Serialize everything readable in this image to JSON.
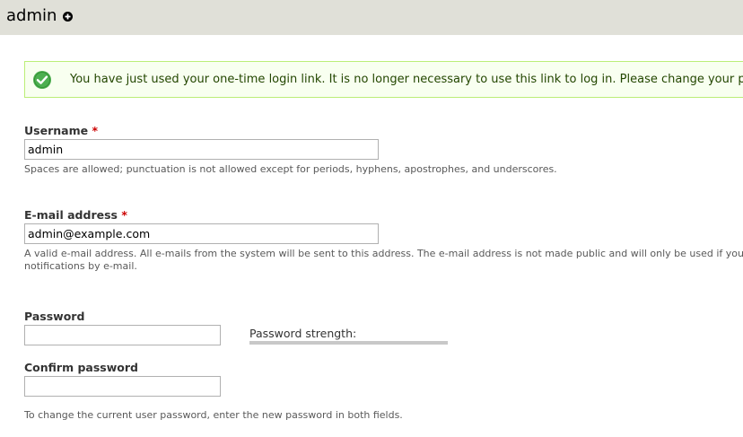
{
  "header": {
    "title": "admin",
    "shortcut_icon": "plus-circle-icon"
  },
  "message": {
    "status": "status",
    "icon": "check-circle-icon",
    "text": "You have just used your one-time login link. It is no longer necessary to use this link to log in. Please change your password."
  },
  "form": {
    "username": {
      "label": "Username",
      "required_marker": "*",
      "value": "admin",
      "description": "Spaces are allowed; punctuation is not allowed except for periods, hyphens, apostrophes, and underscores."
    },
    "email": {
      "label": "E-mail address",
      "required_marker": "*",
      "value": "admin@example.com",
      "description_line1": "A valid e-mail address. All e-mails from the system will be sent to this address. The e-mail address is not made public and will only be used if you wis",
      "description_line2": "notifications by e-mail."
    },
    "password": {
      "label": "Password",
      "value": "",
      "strength_label": "Password strength:",
      "strength_value": "",
      "strength_fill_percent": 0
    },
    "confirm_password": {
      "label": "Confirm password",
      "value": ""
    },
    "password_description": "To change the current user password, enter the new password in both fields."
  },
  "colors": {
    "header_bg": "#e0e0d8",
    "message_bg": "#f8fff0",
    "message_border": "#bbee77",
    "message_text": "#234600",
    "check_icon": "#4caf50",
    "required": "#cc0000",
    "strength_track": "#c8c8c8"
  }
}
